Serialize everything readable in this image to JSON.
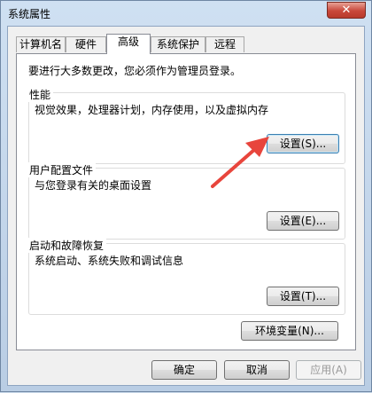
{
  "window": {
    "title": "系统属性",
    "close_glyph": "✕"
  },
  "tabs": [
    {
      "label": "计算机名",
      "active": false
    },
    {
      "label": "硬件",
      "active": false
    },
    {
      "label": "高级",
      "active": true
    },
    {
      "label": "系统保护",
      "active": false
    },
    {
      "label": "远程",
      "active": false
    }
  ],
  "advanced": {
    "intro": "要进行大多数更改，您必须作为管理员登录。",
    "performance": {
      "title": "性能",
      "description": "视觉效果，处理器计划，内存使用，以及虚拟内存",
      "button": "设置(S)..."
    },
    "user_profiles": {
      "title": "用户配置文件",
      "description": "与您登录有关的桌面设置",
      "button": "设置(E)..."
    },
    "startup_recovery": {
      "title": "启动和故障恢复",
      "description": "系统启动、系统失败和调试信息",
      "button": "设置(T)..."
    },
    "env_button": "环境变量(N)..."
  },
  "footer": {
    "ok": "确定",
    "cancel": "取消",
    "apply": "应用(A)"
  },
  "annotation": {
    "arrow_color": "#e8453c"
  }
}
